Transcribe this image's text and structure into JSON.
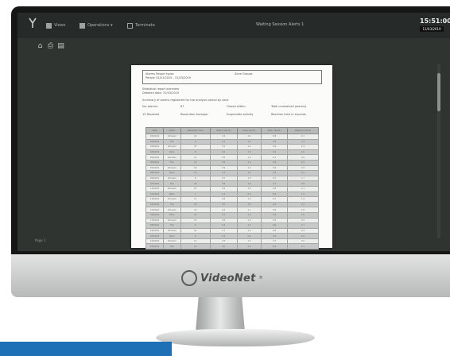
{
  "app": {
    "menu": [
      {
        "icon": "view-icon",
        "label": "Views"
      },
      {
        "icon": "operations-icon",
        "label": "Operations ▾"
      },
      {
        "icon": "exit-icon",
        "label": "Terminate"
      }
    ],
    "window_title": "Waiting Session Alerts 1",
    "clock": {
      "time": "15:51:00",
      "date": "11/03/2019"
    },
    "toolbar": [
      "home-icon",
      "print-icon",
      "export-icon"
    ],
    "page_label": "Page 1"
  },
  "document": {
    "header": [
      {
        "line1": "Alarms    Report types",
        "line2": "Period: 01/01/2019 - 31/03/2019"
      },
      {
        "line1": "",
        "line2": "Zone Groups"
      }
    ],
    "meta": [
      "Statistical report overview",
      "Detailed data:    31/03/2019"
    ],
    "summary_title": "Summary of alarms registered for the analysis period by zone",
    "summary_rows": [
      [
        "No. alarms:",
        "67",
        "Closed within:",
        "Total unresolved (alarms)"
      ],
      [
        "15 Resolved",
        "Resolution Average:",
        "Suspended activity",
        "Reaction time in seconds"
      ]
    ],
    "table": {
      "headers": [
        "Date",
        "Alarm",
        "Resolution time",
        "Object (Sec/1)",
        "Zone (Sec/1)",
        "Alarm (Sec/1)",
        "Dispatch (Sec/1)"
      ],
      "rows": [
        [
          "01/01/19",
          "Intrusion",
          "12",
          "3.4",
          "1.2",
          "0.8",
          "2.1"
        ],
        [
          "02/01/19",
          "Fire",
          "9",
          "2.7",
          "1.5",
          "0.6",
          "1.9"
        ],
        [
          "03/01/19",
          "Intrusion",
          "15",
          "3.1",
          "1.1",
          "0.9",
          "2.4"
        ],
        [
          "04/01/19",
          "Panic",
          "8",
          "2.2",
          "1.0",
          "0.5",
          "1.6"
        ],
        [
          "05/01/19",
          "Intrusion",
          "11",
          "3.0",
          "1.3",
          "0.7",
          "2.0"
        ],
        [
          "06/01/19",
          "Fire",
          "14",
          "3.6",
          "1.4",
          "0.8",
          "2.3"
        ],
        [
          "07/01/19",
          "Intrusion",
          "10",
          "2.9",
          "1.2",
          "0.6",
          "1.8"
        ],
        [
          "08/01/19",
          "Panic",
          "13",
          "3.3",
          "1.1",
          "0.9",
          "2.2"
        ],
        [
          "09/01/19",
          "Intrusion",
          "9",
          "2.5",
          "1.0",
          "0.7",
          "1.7"
        ],
        [
          "10/01/19",
          "Fire",
          "16",
          "3.8",
          "1.6",
          "1.0",
          "2.6"
        ],
        [
          "11/01/19",
          "Intrusion",
          "12",
          "3.2",
          "1.3",
          "0.8",
          "2.1"
        ],
        [
          "12/01/19",
          "Panic",
          "7",
          "2.1",
          "0.9",
          "0.5",
          "1.5"
        ],
        [
          "13/01/19",
          "Intrusion",
          "11",
          "2.8",
          "1.2",
          "0.7",
          "1.9"
        ],
        [
          "14/01/19",
          "Fire",
          "15",
          "3.5",
          "1.5",
          "0.9",
          "2.4"
        ],
        [
          "15/01/19",
          "Intrusion",
          "10",
          "2.6",
          "1.1",
          "0.6",
          "1.8"
        ],
        [
          "16/01/19",
          "Panic",
          "12",
          "3.1",
          "1.2",
          "0.8",
          "2.0"
        ],
        [
          "17/01/19",
          "Intrusion",
          "13",
          "3.4",
          "1.3",
          "0.9",
          "2.2"
        ],
        [
          "18/01/19",
          "Fire",
          "9",
          "2.4",
          "1.0",
          "0.6",
          "1.7"
        ],
        [
          "19/01/19",
          "Intrusion",
          "14",
          "3.7",
          "1.4",
          "0.8",
          "2.3"
        ],
        [
          "20/01/19",
          "Panic",
          "8",
          "2.3",
          "0.9",
          "0.5",
          "1.6"
        ],
        [
          "21/01/19",
          "Intrusion",
          "11",
          "2.9",
          "1.2",
          "0.7",
          "2.0"
        ],
        [
          "22/01/19",
          "Fire",
          "12",
          "3.0",
          "1.3",
          "0.8",
          "2.1"
        ]
      ]
    }
  },
  "brand": {
    "name": "VideoNet",
    "mark": "®"
  },
  "colors": {
    "accent_bar": "#1d6fb6",
    "screen_bg": "#2f3431",
    "bezel": "#151716"
  }
}
